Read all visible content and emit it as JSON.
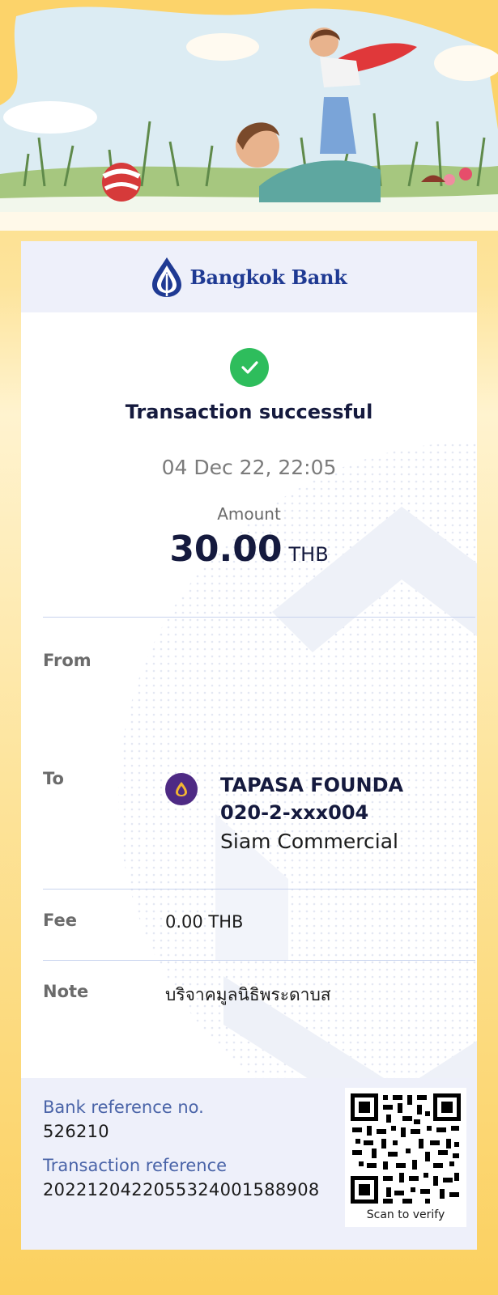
{
  "bank": {
    "name": "Bangkok Bank",
    "brand_color": "#1f3a93"
  },
  "status": {
    "icon": "check-icon",
    "title": "Transaction successful",
    "datetime": "04 Dec 22, 22:05",
    "success_color": "#2ebd5c"
  },
  "amount": {
    "label": "Amount",
    "value": "30.00",
    "currency": "THB"
  },
  "details": {
    "from_label": "From",
    "to_label": "To",
    "to_bank_icon": "scb-bank-icon",
    "to_name": "TAPASA FOUNDA",
    "to_account": "020-2-xxx004",
    "to_bank": "Siam Commercial",
    "fee_label": "Fee",
    "fee_value": "0.00 THB",
    "note_label": "Note",
    "note_value": "บริจาคมูลนิธิพระดาบส"
  },
  "references": {
    "bank_ref_label": "Bank reference no.",
    "bank_ref_value": "526210",
    "txn_ref_label": "Transaction reference",
    "txn_ref_value": "2022120422055324001588908"
  },
  "qr": {
    "caption": "Scan to verify",
    "icon": "qr-code-icon"
  }
}
